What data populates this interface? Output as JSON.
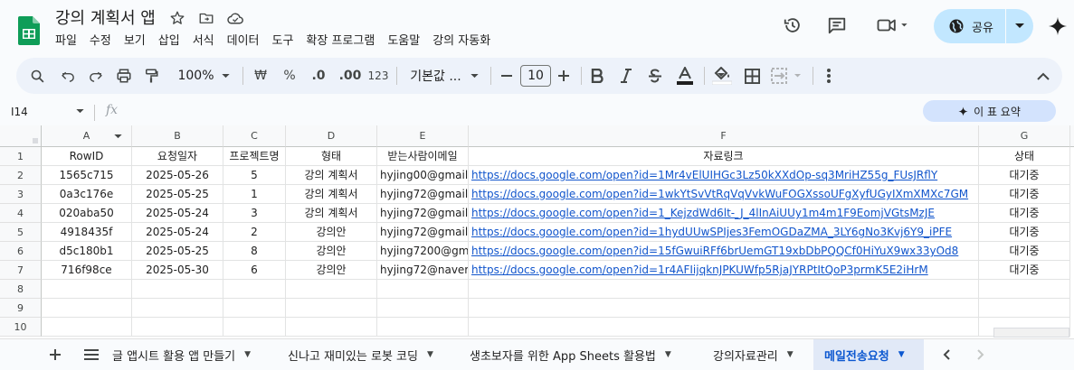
{
  "document": {
    "title": "강의 계획서 앱",
    "menu": [
      "파일",
      "수정",
      "보기",
      "삽입",
      "서식",
      "데이터",
      "도구",
      "확장 프로그램",
      "도움말",
      "강의 자동화"
    ]
  },
  "header": {
    "share_label": "공유"
  },
  "toolbar": {
    "zoom": "100%",
    "currency": "₩",
    "percent": "%",
    "decrease_decimal": ".0",
    "increase_decimal": ".00",
    "number_format": "123",
    "font_name": "기본값 ...",
    "font_size": "10"
  },
  "formula_bar": {
    "cell_ref": "I14",
    "fx": "fx"
  },
  "summary_button": "이 표 요약",
  "columns": [
    "A",
    "B",
    "C",
    "D",
    "E",
    "F",
    "G"
  ],
  "row_numbers": [
    "1",
    "2",
    "3",
    "4",
    "5",
    "6",
    "7",
    "8",
    "9",
    "10"
  ],
  "table": {
    "headers": [
      "RowID",
      "요청일자",
      "프로젝트명",
      "형태",
      "받는사람이메일",
      "자료링크",
      "상태"
    ],
    "rows": [
      [
        "1565c715",
        "2025-05-26",
        "5",
        "강의 계획서",
        "hyjing00@gmail.",
        "https://docs.google.com/open?id=1Mr4vElUIHGc3Lz50kXXdOp-sq3MriHZ55g_FUsJRflY",
        "대기중"
      ],
      [
        "0a3c176e",
        "2025-05-25",
        "1",
        "강의 계획서",
        "hyjing72@gmail.",
        "https://docs.google.com/open?id=1wkYtSvVtRqVqVvkWuFOGXssoUFgXyfUGyIXmXMXc7GM",
        "대기중"
      ],
      [
        "020aba50",
        "2025-05-24",
        "3",
        "강의 계획서",
        "hyjing72@gmail.",
        "https://docs.google.com/open?id=1_KejzdWd6lt-_J_4lInAiUUy1m4m1F9EomjVGtsMzJE",
        "대기중"
      ],
      [
        "4918435f",
        "2025-05-24",
        "2",
        "강의안",
        "hyjing72@gmail.",
        "https://docs.google.com/open?id=1hydUUwSPIjes3FemOGDaZMA_3LY6gNo3Kvj6Y9_iPFE",
        "대기중"
      ],
      [
        "d5c180b1",
        "2025-05-25",
        "8",
        "강의안",
        "hyjing7200@gm",
        "https://docs.google.com/open?id=15fGwuiRFf6brUemGT19xbDbPQQCf0HiYuX9wx33yOd8",
        "대기중"
      ],
      [
        "716f98ce",
        "2025-05-30",
        "6",
        "강의안",
        "hyjing72@naver",
        "https://docs.google.com/open?id=1r4AFIijqknJPKUWfp5RjaJYRPtItQoP3prmK5E2iHrM",
        "대기중"
      ]
    ]
  },
  "sheet_tabs": [
    "글 앱시트 활용 앱 만들기",
    "신나고 재미있는 로봇 코딩",
    "생초보자를 위한 App Sheets 활용법",
    "강의자료관리",
    "메일전송요청"
  ],
  "active_sheet": "메일전송요청",
  "colors": {
    "accent": "#0b57d0",
    "share_bg": "#c2e7ff",
    "link": "#1155cc",
    "sheets_green": "#0f9d58"
  }
}
